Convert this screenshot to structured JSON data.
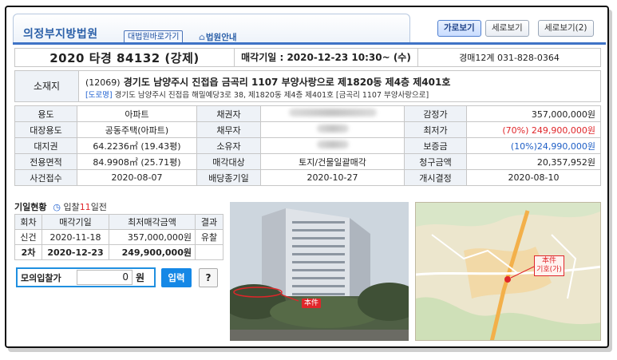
{
  "header": {
    "court_name": "의정부지방법원",
    "court_link_label": "대법원바로가기",
    "court_info_label": "법원안내",
    "view_buttons": [
      "가로보기",
      "세로보기",
      "세로보기(2)"
    ]
  },
  "case": {
    "number": "2020 타경 84132 (강제)",
    "sale_date": "매각기일 : 2020-12-23 10:30~ (수)",
    "department": "경매12계 031-828-0364"
  },
  "address": {
    "label": "소재지",
    "zip": "(12069)",
    "main": "경기도 남양주시 진접읍 금곡리 1107 부양사랑으로 제1820동 제4층 제401호",
    "road_tag": "[도로명]",
    "road": "경기도 남양주시 진접읍 해밀예당3로 38, 제1820동 제4층 제401호 [금곡리 1107 부양사랑으로]"
  },
  "info_rows": [
    {
      "l1": "용도",
      "v1": "아파트",
      "l2": "채권자",
      "l3": "감정가",
      "v3": "357,000,000원"
    },
    {
      "l1": "대장용도",
      "v1": "공동주택(아파트)",
      "l2": "채무자",
      "l3": "최저가",
      "v3": "(70%) 249,900,000원"
    },
    {
      "l1": "대지권",
      "v1": "64.2236㎡ (19.43평)",
      "l2": "소유자",
      "l3": "보증금",
      "v3": "(10%)24,990,000원"
    },
    {
      "l1": "전용면적",
      "v1": "84.9908㎡ (25.71평)",
      "l2": "매각대상",
      "v2": "토지/건물일괄매각",
      "l3": "청구금액",
      "v3": "20,357,952원"
    },
    {
      "l1": "사건접수",
      "v1": "2020-08-07",
      "l2": "배당종기일",
      "v2": "2020-10-27",
      "l3": "개시결정",
      "v3": "2020-08-10"
    }
  ],
  "history": {
    "title": "기일현황",
    "subtitle_prefix": "입찰",
    "subtitle_num": "11",
    "subtitle_suffix": "일전",
    "headers": [
      "회차",
      "매각기일",
      "최저매각금액",
      "결과"
    ],
    "rows": [
      {
        "round": "신건",
        "date": "2020-11-18",
        "price": "357,000,000원",
        "result": "유찰"
      },
      {
        "round": "2차",
        "date": "2020-12-23",
        "price": "249,900,000원",
        "result": ""
      }
    ]
  },
  "mock_bid": {
    "label": "모의입찰가",
    "value": "0",
    "unit": "원",
    "submit_label": "입력",
    "help_label": "?"
  },
  "photo": {
    "tag": "本件"
  },
  "map": {
    "tag_line1": "本件",
    "tag_line2": "기호(가)"
  },
  "colors": {
    "accent_blue": "#2a5fa8",
    "price_red": "#e0262a",
    "deposit_blue": "#1f5fc6",
    "button_blue": "#1588e6"
  }
}
